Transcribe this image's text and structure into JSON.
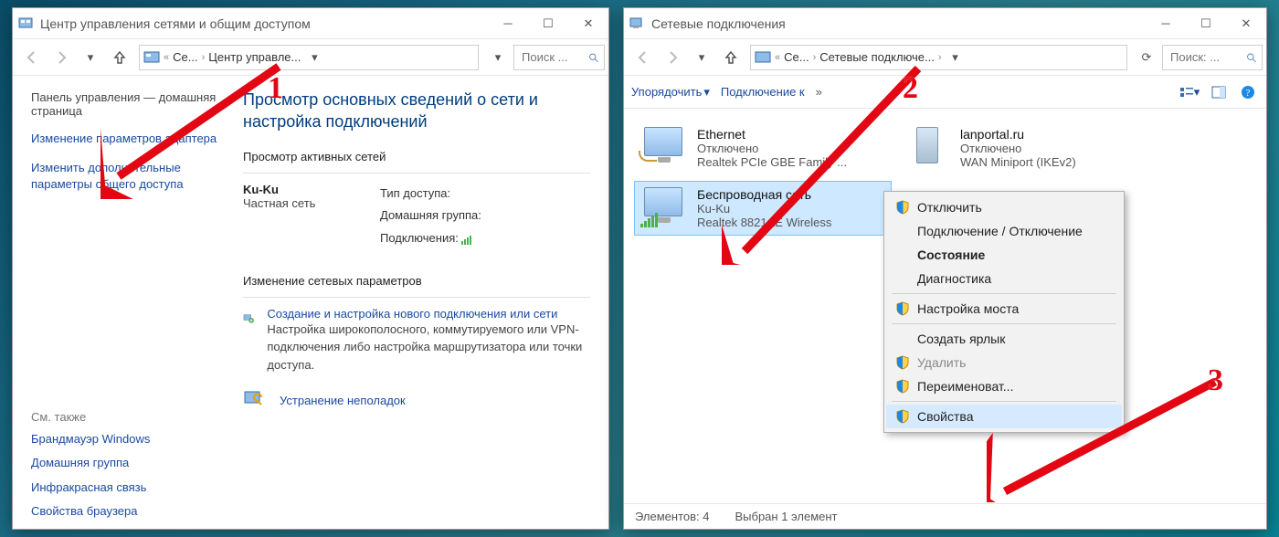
{
  "win1": {
    "title": "Центр управления сетями и общим доступом",
    "path_seg1": "Се...",
    "path_seg2": "Центр управле...",
    "search_ph": "Поиск ...",
    "side": {
      "cp_home": "Панель управления — домашняя страница",
      "link_adapter": "Изменение параметров адаптера",
      "link_sharing": "Изменить дополнительные параметры общего доступа",
      "see_also": "См. также",
      "see1": "Брандмауэр Windows",
      "see2": "Домашняя группа",
      "see3": "Инфракрасная связь",
      "see4": "Свойства браузера"
    },
    "main": {
      "h1": "Просмотр основных сведений о сети и настройка подключений",
      "active_head": "Просмотр активных сетей",
      "net_name": "Ku-Ku",
      "net_kind": "Частная сеть",
      "k_access": "Тип доступа:",
      "k_homegrp": "Домашняя группа:",
      "k_conns": "Подключения:",
      "change_head": "Изменение сетевых параметров",
      "task1_title": "Создание и настройка нового подключения или сети",
      "task1_desc": "Настройка широкополосного, коммутируемого или VPN-подключения либо настройка маршрутизатора или точки доступа.",
      "task2_title": "Устранение неполадок"
    }
  },
  "win2": {
    "title": "Сетевые подключения",
    "path_seg1": "Се...",
    "path_seg2": "Сетевые подключе...",
    "search_ph": "Поиск: ...",
    "cmd_sort": "Упорядочить",
    "cmd_connect": "Подключение к",
    "conns": {
      "eth_name": "Ethernet",
      "eth_state": "Отключено",
      "eth_dev": "Realtek PCIe GBE Family ...",
      "lan_name": "lanportal.ru",
      "lan_state": "Отключено",
      "lan_dev": "WAN Miniport (IKEv2)",
      "wifi_name": "Беспроводная сеть",
      "wifi_state": "Ku-Ku",
      "wifi_dev": "Realtek 8821AE Wireless"
    },
    "ctx": {
      "disable": "Отключить",
      "connect": "Подключение / Отключение",
      "status": "Состояние",
      "diag": "Диагностика",
      "bridge": "Настройка моста",
      "shortcut": "Создать ярлык",
      "delete": "Удалить",
      "rename": "Переименоват...",
      "props": "Свойства"
    },
    "status_items": "Элементов: 4",
    "status_sel": "Выбран 1 элемент"
  },
  "anno": {
    "n1": "1",
    "n2": "2",
    "n3": "3"
  }
}
